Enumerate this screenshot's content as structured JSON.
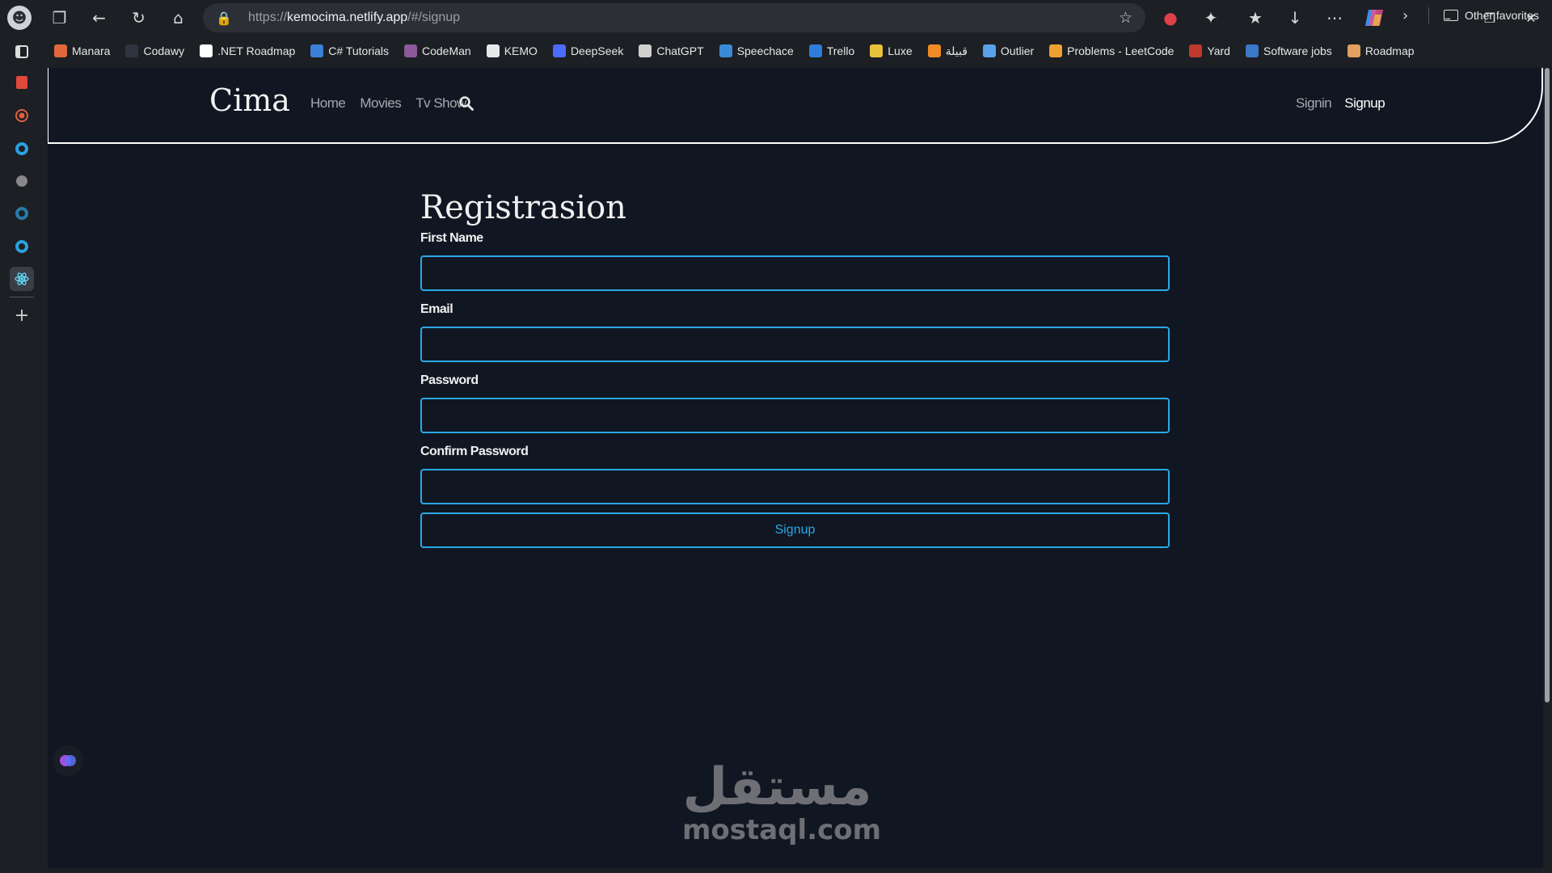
{
  "browser": {
    "url_prefix": "https://",
    "url_host": "kemocima.netlify.app",
    "url_path": "/#/signup"
  },
  "favorites": [
    {
      "label": "Manara",
      "color": "#e0683c"
    },
    {
      "label": "Codawy",
      "color": "#2f3440"
    },
    {
      "label": ".NET Roadmap",
      "color": "#ffffff"
    },
    {
      "label": "C# Tutorials",
      "color": "#3c7fd6"
    },
    {
      "label": "CodeMan",
      "color": "#8a5a9a"
    },
    {
      "label": "KEMO",
      "color": "#e8e8e8"
    },
    {
      "label": "DeepSeek",
      "color": "#4b6bfb"
    },
    {
      "label": "ChatGPT",
      "color": "#d0d0d0"
    },
    {
      "label": "Speechace",
      "color": "#3a8ad6"
    },
    {
      "label": "Trello",
      "color": "#2d7fd9"
    },
    {
      "label": "Luxe",
      "color": "#e8c33a"
    },
    {
      "label": "قبيلة",
      "color": "#f08a24"
    },
    {
      "label": "Outlier",
      "color": "#5aa0e8"
    },
    {
      "label": "Problems - LeetCode",
      "color": "#f0a030"
    },
    {
      "label": "Yard",
      "color": "#c0392b"
    },
    {
      "label": "Software jobs",
      "color": "#3a78c8"
    },
    {
      "label": "Roadmap",
      "color": "#e0a060"
    }
  ],
  "favorites_other": "Other favorites",
  "site": {
    "brand": "Cima",
    "nav": [
      "Home",
      "Movies",
      "Tv Show"
    ],
    "signin": "Signin",
    "signup": "Signup"
  },
  "form": {
    "title": "Registrasion",
    "fields": [
      {
        "label": "First Name",
        "value": ""
      },
      {
        "label": "Email",
        "value": ""
      },
      {
        "label": "Password",
        "value": ""
      },
      {
        "label": "Confirm Password",
        "value": ""
      }
    ],
    "submit": "Signup"
  },
  "watermark": {
    "arabic": "مستقل",
    "latin": "mostaql.com"
  },
  "colors": {
    "accent": "#2aa8e6",
    "page_bg": "#111722"
  }
}
